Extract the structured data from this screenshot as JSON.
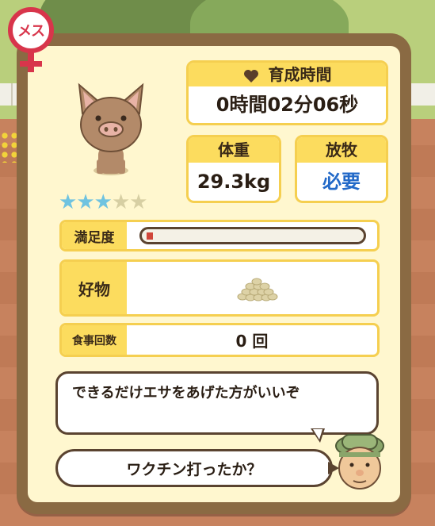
{
  "gender": {
    "label": "メス",
    "color": "#d8354b"
  },
  "stars": {
    "filled": 3,
    "total": 5,
    "filled_color": "#6fc3e0",
    "empty_color": "#d7cfa3"
  },
  "raise_time": {
    "label": "育成時間",
    "value": "0時間02分06秒",
    "icon": "heart-icon"
  },
  "weight": {
    "label": "体重",
    "value": "29.3kg"
  },
  "grazing": {
    "label": "放牧",
    "value": "必要",
    "value_color": "#2269c8"
  },
  "satisfaction": {
    "label": "満足度",
    "level_fraction": 0.03
  },
  "favorite": {
    "label": "好物",
    "icon": "grain-pile-icon"
  },
  "meals": {
    "label": "食事回数",
    "value": "0 回"
  },
  "dialog": {
    "bubble1": "できるだけエサをあげた方がいいぞ",
    "bubble2": "ワクチン打ったか？"
  },
  "colors": {
    "panel_border": "#8a6a43",
    "panel_bg": "#fff7cf",
    "box_header": "#fcdc5e",
    "box_border": "#f5cf50"
  }
}
